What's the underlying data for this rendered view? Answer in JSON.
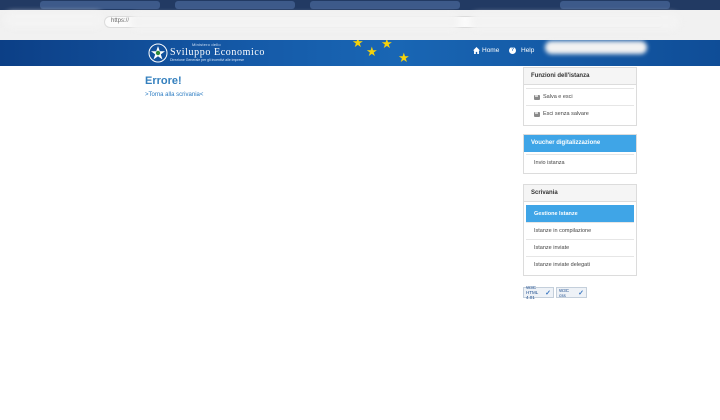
{
  "browser": {
    "url_prefix": "https://"
  },
  "header": {
    "logo_small": "Ministero dello",
    "logo_title": "Sviluppo Economico",
    "logo_subtitle": "Direzione Generale per gli incentivi alle imprese",
    "nav_home": "Home",
    "nav_help": "Help"
  },
  "main": {
    "title": "Errore!",
    "back_link": ">Torna alla scrivania<"
  },
  "panels": {
    "funzioni": {
      "title": "Funzioni dell'istanza",
      "items": [
        "Salva e esci",
        "Esci senza salvare"
      ]
    },
    "voucher": {
      "title": "Voucher digitalizzazione",
      "items": [
        "Invio istanza"
      ]
    },
    "scrivania": {
      "title": "Scrivania",
      "items": [
        "Gestione Istanze",
        "Istanze in compilazione",
        "Istanze inviate",
        "Istanze inviate delegati"
      ]
    }
  },
  "badges": {
    "html": "W3C HTML 4.01",
    "css": "W3C css"
  },
  "colors": {
    "header_blue": "#155aa8",
    "accent_blue": "#3fa5e7",
    "title_blue": "#3580be",
    "eu_star": "#f5d20b"
  }
}
